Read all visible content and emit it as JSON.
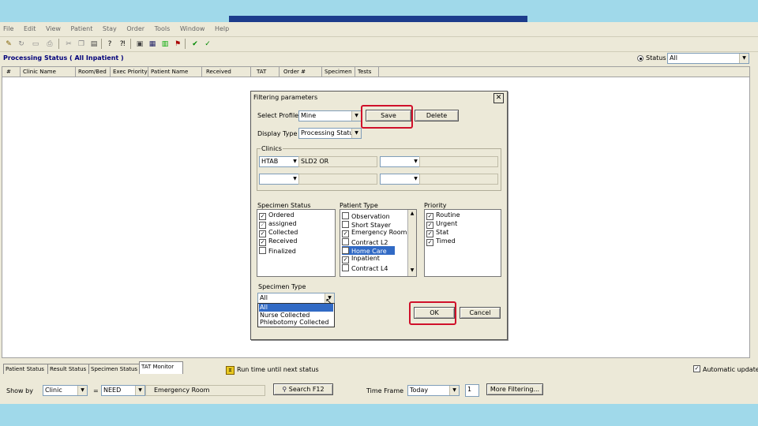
{
  "menu": [
    "File",
    "Edit",
    "View",
    "Patient",
    "Stay",
    "Order",
    "Tools",
    "Window",
    "Help"
  ],
  "header": {
    "title": "Processing Status ( All Inpatient )",
    "status_label": "Status",
    "status_value": "All"
  },
  "grid": {
    "columns": [
      "#",
      "Clinic Name",
      "Room/Bed",
      "Exec Priority",
      "Patient Name",
      "Received",
      "TAT",
      "Order #",
      "Specimen",
      "Tests"
    ]
  },
  "dialog": {
    "title": "Filtering parameters",
    "close": "X",
    "select_profile_label": "Select Profile",
    "select_profile_value": "Mine",
    "save_label": "Save",
    "delete_label": "Delete",
    "display_type_label": "Display Type",
    "display_type_value": "Processing Status",
    "clinics_label": "Clinics",
    "clinic_1_code": "HTAB",
    "clinic_1_name": "SLD2 OR",
    "specimen_status_label": "Specimen Status",
    "specimen_status": [
      {
        "label": "Ordered",
        "checked": true
      },
      {
        "label": "assigned",
        "checked": true
      },
      {
        "label": "Collected",
        "checked": true
      },
      {
        "label": "Received",
        "checked": true
      },
      {
        "label": "Finalized",
        "checked": false
      }
    ],
    "patient_type_label": "Patient Type",
    "patient_type": [
      {
        "label": "Observation",
        "checked": false
      },
      {
        "label": "Short Stayer",
        "checked": false
      },
      {
        "label": "Emergency Room",
        "checked": true
      },
      {
        "label": "Contract L2",
        "checked": false
      },
      {
        "label": "Home Care",
        "checked": false
      },
      {
        "label": "Inpatient",
        "checked": true
      },
      {
        "label": "Contract L4",
        "checked": false
      }
    ],
    "priority_label": "Priority",
    "priority": [
      {
        "label": "Routine",
        "checked": true
      },
      {
        "label": "Urgent",
        "checked": true
      },
      {
        "label": "Stat",
        "checked": true
      },
      {
        "label": "Timed",
        "checked": true
      }
    ],
    "specimen_type_label": "Specimen Type",
    "specimen_type_value": "All",
    "specimen_type_options": [
      "All",
      "Nurse Collected",
      "Phlebotomy Collected"
    ],
    "ok_label": "OK",
    "cancel_label": "Cancel"
  },
  "tabs": [
    "Patient Status",
    "Result Status",
    "Specimen Status",
    "TAT Monitor"
  ],
  "footer_status": {
    "update_label": "Run time until next status",
    "auto_update_label": "Automatic update",
    "auto_update_checked": true
  },
  "bottom": {
    "show_by_label": "Show by",
    "show_by_value": "Clinic",
    "equals": "=",
    "clinic_code": "NEED",
    "clinic_name": "Emergency Room",
    "search_label": "Search F12",
    "time_frame_label": "Time Frame",
    "time_frame_value": "Today",
    "count_value": "1",
    "more_filtering_label": "More Filtering..."
  },
  "colors": {
    "highlight_red": "#d0102a",
    "selection_blue": "#316ac5",
    "background": "#a0d9ea"
  }
}
